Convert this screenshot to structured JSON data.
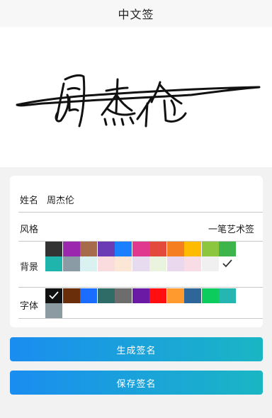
{
  "header": {
    "title": "中文签"
  },
  "preview": {
    "signature_icon": "handwritten-signature-image"
  },
  "form": {
    "name_label": "姓名",
    "name_value": "周杰伦",
    "style_label": "风格",
    "style_value": "一笔艺术签",
    "background_label": "背景",
    "font_label": "字体"
  },
  "background_colors": [
    "#333333",
    "#9b27af",
    "#a66b4a",
    "#6a3bb5",
    "#1a80ff",
    "#e0378f",
    "#e34a3c",
    "#f57f20",
    "#ffbb00",
    "#8cc63f",
    "#3db54a",
    "#1fb5ad",
    "#8a9ba5",
    "#d9f1f1",
    "#fbdcde",
    "#fce6d5",
    "#e7dbf0",
    "#e9f3dd",
    "#ead9ee",
    "#f8dde6",
    "#f0f0f0",
    "#ffffff"
  ],
  "background_selected": 21,
  "font_colors": [
    "#111111",
    "#6b2e0b",
    "#1a6dff",
    "#2f6c68",
    "#6d6d6d",
    "#6a1aa4",
    "#ff0f0f",
    "#ff9a2e",
    "#2f6699",
    "#0bcc5c",
    "#25b6b1",
    "#8c9aa2"
  ],
  "font_selected": 0,
  "buttons": {
    "generate": "生成签名",
    "save": "保存签名"
  }
}
